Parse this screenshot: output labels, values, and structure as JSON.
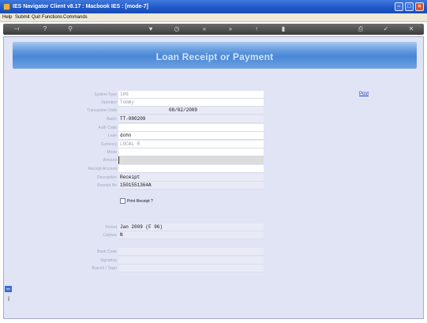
{
  "window": {
    "title": "IES Navigator Client v8.17 : Macbook IES :     [mode-7]",
    "minimize_glyph": "–",
    "maximize_glyph": "□",
    "close_glyph": "×"
  },
  "menu": {
    "items": [
      "Help",
      "Submit",
      "Quit",
      "Functions",
      "Commands"
    ]
  },
  "toolbar": {
    "icons": [
      "exit-icon",
      "help-icon",
      "search-icon",
      "favorite-icon",
      "clock-icon",
      "back-icon",
      "forward-icon",
      "up-icon",
      "document-icon",
      "print-icon",
      "confirm-icon",
      "close-icon"
    ]
  },
  "banner": {
    "title": "Loan Receipt or Payment"
  },
  "form": {
    "rows": [
      {
        "label": "System Type",
        "value": "186"
      },
      {
        "label": "Operator",
        "value": "Tommy"
      },
      {
        "label": "Transaction Date",
        "value": "08/02/2009"
      },
      {
        "label": "Batch",
        "value": "TT-080209"
      },
      {
        "label": "Auth Code",
        "value": ""
      },
      {
        "label": "Loan",
        "value": "dohn"
      },
      {
        "label": "Currency",
        "value": "LOCAL R"
      },
      {
        "label": "Mode",
        "value": ""
      },
      {
        "label": "Amount",
        "value": ""
      },
      {
        "label": "Receipt Account",
        "value": ""
      },
      {
        "label": "Description",
        "value": "Receipt"
      },
      {
        "label": "Receipt No",
        "value": "1501551364A"
      }
    ],
    "print_receipt_label": "Print Receipt ?",
    "period_label": "Period",
    "period_value": "Jan 2009 (F 96)",
    "capture_label": "Capture",
    "capture_value": "N",
    "bank_code_label": "Bank Code",
    "signatory_label": "Signatory",
    "branch_label": "Branch / Town",
    "post_label": "Post"
  },
  "sidebar": {
    "badge": "ies",
    "info_glyph": "i"
  }
}
